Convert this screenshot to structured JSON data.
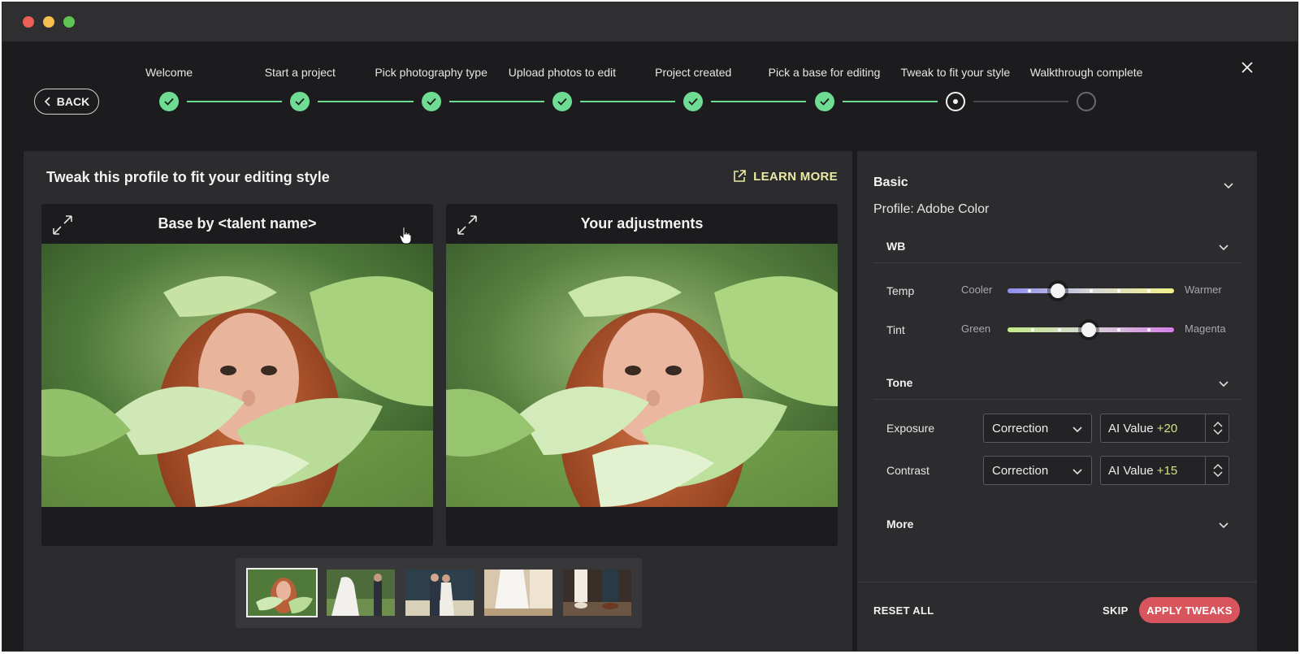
{
  "colors": {
    "window_bg": "#1c1c1e",
    "panel_bg": "#2c2c2f",
    "step_done": "#6fdc93",
    "learn_more": "#e9eaa4",
    "apply_button": "#d9555e"
  },
  "header": {
    "back_label": "BACK",
    "close_icon": "close-icon"
  },
  "stepper": {
    "steps": [
      {
        "label": "Welcome",
        "state": "done"
      },
      {
        "label": "Start a project",
        "state": "done"
      },
      {
        "label": "Pick photography type",
        "state": "done"
      },
      {
        "label": "Upload photos to edit",
        "state": "done"
      },
      {
        "label": "Project created",
        "state": "done"
      },
      {
        "label": "Pick a base for editing",
        "state": "done"
      },
      {
        "label": "Tweak to fit your style",
        "state": "current"
      },
      {
        "label": "Walkthrough complete",
        "state": "todo"
      }
    ]
  },
  "main": {
    "title": "Tweak this profile to fit your editing style",
    "learn_more": "LEARN MORE",
    "base_card_title": "Base by <talent name>",
    "adjust_card_title": "Your adjustments",
    "thumbnails": [
      {
        "name": "portrait-leaves",
        "selected": true
      },
      {
        "name": "bride-walking",
        "selected": false
      },
      {
        "name": "couple-field",
        "selected": false
      },
      {
        "name": "bride-dress-doorway",
        "selected": false
      },
      {
        "name": "couple-shoes",
        "selected": false
      }
    ]
  },
  "sidebar": {
    "basic_title": "Basic",
    "profile": "Profile: Adobe Color",
    "wb": {
      "title": "WB",
      "temp": {
        "label": "Temp",
        "min_label": "Cooler",
        "max_label": "Warmer",
        "value": 0.3
      },
      "tint": {
        "label": "Tint",
        "min_label": "Green",
        "max_label": "Magenta",
        "value": 0.49
      }
    },
    "tone": {
      "title": "Tone",
      "exposure": {
        "label": "Exposure",
        "mode": "Correction",
        "ai_label": "AI Value",
        "ai_delta": "+20"
      },
      "contrast": {
        "label": "Contrast",
        "mode": "Correction",
        "ai_label": "AI Value",
        "ai_delta": "+15"
      }
    },
    "more": {
      "title": "More"
    },
    "footer": {
      "reset_label": "RESET ALL",
      "skip_label": "SKIP",
      "apply_label": "APPLY TWEAKS"
    }
  }
}
